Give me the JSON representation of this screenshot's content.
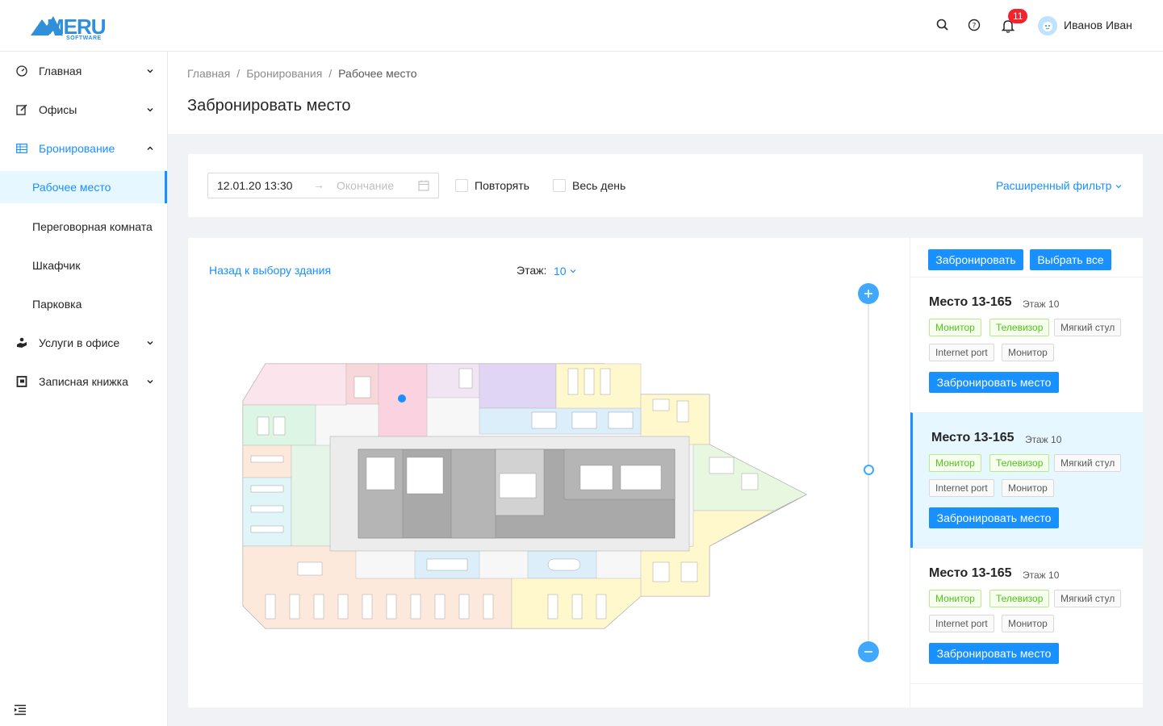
{
  "header": {
    "logo_text": "MERU",
    "logo_sub": "SOFTWARE",
    "notifications_count": "11",
    "user_name": "Иванов Иван"
  },
  "sidebar": {
    "items": [
      {
        "label": "Главная"
      },
      {
        "label": "Офисы"
      },
      {
        "label": "Бронирование"
      },
      {
        "label": "Услуги в офисе"
      },
      {
        "label": "Записная книжка"
      }
    ],
    "subitems": [
      {
        "label": "Рабочее место"
      },
      {
        "label": "Переговорная комната"
      },
      {
        "label": "Шкафчик"
      },
      {
        "label": "Парковка"
      }
    ]
  },
  "breadcrumb": [
    "Главная",
    "Бронирования",
    "Рабочее место"
  ],
  "page_title": "Забронировать место",
  "filter": {
    "start_value": "12.01.20 13:30",
    "end_placeholder": "Окончание",
    "repeat_label": "Повторять",
    "allday_label": "Весь день",
    "advanced_label": "Расширенный фильтр"
  },
  "map": {
    "back_label": "Назад к выбору здания",
    "floor_label": "Этаж:",
    "floor_value": "10"
  },
  "list": {
    "book_label": "Забронировать",
    "select_all_label": "Выбрать все",
    "cards": [
      {
        "title": "Место 13-165",
        "floor": "Этаж 10",
        "tags": [
          "Монитор",
          "Телевизор",
          "Мягкий стул",
          "Internet port",
          "Монитор"
        ],
        "button": "Забронировать место"
      },
      {
        "title": "Место 13-165",
        "floor": "Этаж 10",
        "tags": [
          "Монитор",
          "Телевизор",
          "Мягкий стул",
          "Internet port",
          "Монитор"
        ],
        "button": "Забронировать место"
      },
      {
        "title": "Место 13-165",
        "floor": "Этаж 10",
        "tags": [
          "Монитор",
          "Телевизор",
          "Мягкий стул",
          "Internet port",
          "Монитор"
        ],
        "button": "Забронировать место"
      }
    ]
  },
  "colors": {
    "accent": "#1890ff",
    "selected_bg": "#e6f7ff",
    "tag_green": "#52c41a"
  }
}
